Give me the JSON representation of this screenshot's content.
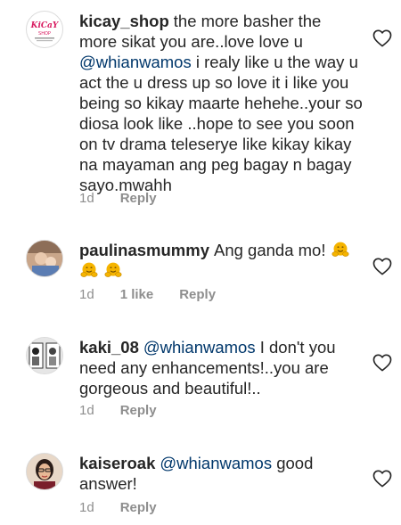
{
  "comments": [
    {
      "username": "kicay_shop",
      "avatar_text": "KiCaY shop",
      "avatar_color": "#d81b60",
      "text_before_mention": "the more basher the more sikat you are..love love u ",
      "mention": "@whianwamos",
      "text_after_mention": " i realy like u the way u act the u dress up so love it i like you being so kikay maarte hehehe..your so diosa look like ..hope to see you soon on tv drama teleserye like kikay kikay na mayaman ang peg bagay n bagay sayo.mwahh",
      "time": "1d",
      "reply_label": "Reply"
    },
    {
      "username": "paulinasmummy",
      "text_before_mention": "Ang ganda mo!",
      "emoji_icons": [
        "hugging-face-emoji-icon",
        "hugging-face-emoji-icon",
        "hugging-face-emoji-icon"
      ],
      "time": "1d",
      "likes_label": "1 like",
      "reply_label": "Reply"
    },
    {
      "username": "kaki_08",
      "mention": "@whianwamos",
      "text_after_mention": " I don't you need any enhancements!..you are gorgeous and beautiful!..",
      "time": "1d",
      "reply_label": "Reply"
    },
    {
      "username": "kaiseroak",
      "mention": "@whianwamos",
      "text_after_mention": " good answer!",
      "time": "1d",
      "reply_label": "Reply"
    }
  ],
  "icons": {
    "like": "heart-outline-icon",
    "emoji": "hugging-face-emoji-icon"
  },
  "colors": {
    "text": "#262626",
    "meta": "#8e8e8e",
    "mention": "#00376b",
    "emoji": "#f5b400"
  }
}
